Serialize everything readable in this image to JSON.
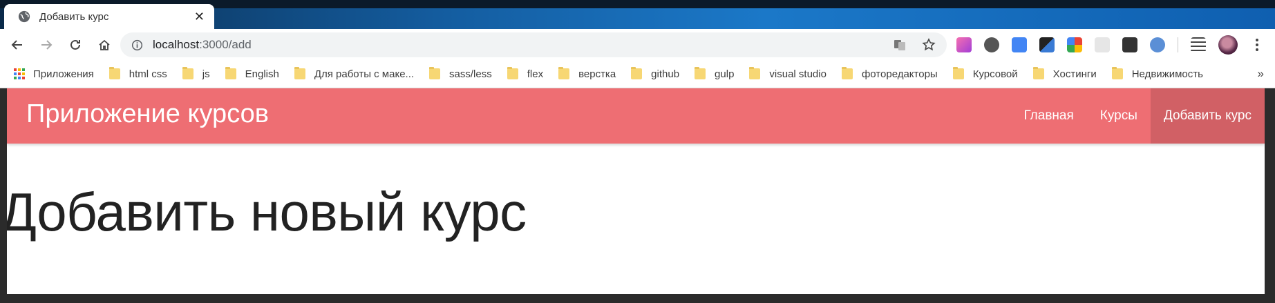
{
  "browser": {
    "tab": {
      "title": "Добавить курс",
      "close_label": "✕"
    },
    "address": {
      "host": "localhost",
      "path": ":3000/add"
    },
    "bookmarks": {
      "apps_label": "Приложения",
      "items": [
        {
          "label": "html css"
        },
        {
          "label": "js"
        },
        {
          "label": "English"
        },
        {
          "label": "Для работы с маке..."
        },
        {
          "label": "sass/less"
        },
        {
          "label": "flex"
        },
        {
          "label": "верстка"
        },
        {
          "label": "github"
        },
        {
          "label": "gulp"
        },
        {
          "label": "visual studio"
        },
        {
          "label": "фоторедакторы"
        },
        {
          "label": "Курсовой"
        },
        {
          "label": "Хостинги"
        },
        {
          "label": "Недвижимость"
        }
      ],
      "more_label": "»"
    }
  },
  "page": {
    "navbar": {
      "brand": "Приложение курсов",
      "links": [
        {
          "label": "Главная",
          "active": false
        },
        {
          "label": "Курсы",
          "active": false
        },
        {
          "label": "Добавить курс",
          "active": true
        }
      ],
      "color": "#ee6e73"
    },
    "heading": "Добавить новый курс"
  }
}
